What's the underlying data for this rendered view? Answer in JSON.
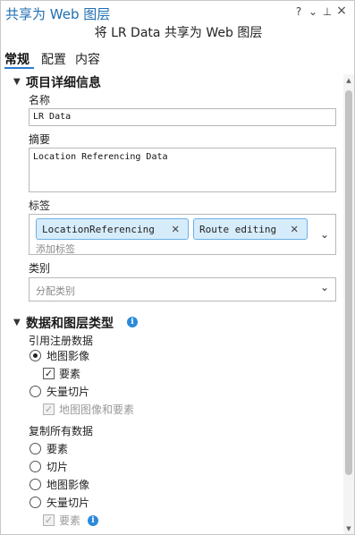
{
  "window": {
    "title": "共享为 Web 图层",
    "controls": {
      "help": "?",
      "menu": "⌄",
      "pin": "⊥",
      "close": "×"
    },
    "subtitle": "将 LR Data 共享为 Web 图层"
  },
  "tabs": [
    {
      "label": "常规",
      "active": true
    },
    {
      "label": "配置",
      "active": false
    },
    {
      "label": "内容",
      "active": false
    }
  ],
  "item_details": {
    "header": "项目详细信息",
    "name_label": "名称",
    "name_value": "LR Data",
    "summary_label": "摘要",
    "summary_value": "Location Referencing Data",
    "tags_label": "标签",
    "tags": [
      "LocationReferencing",
      "Route editing"
    ],
    "tags_placeholder": "添加标签",
    "category_label": "类别",
    "category_placeholder": "分配类别"
  },
  "data_layer": {
    "header": "数据和图层类型",
    "reference_group": "引用注册数据",
    "reference_options": [
      {
        "label": "地图影像",
        "selected": true
      },
      {
        "sub": "要素",
        "checked": true,
        "disabled": false
      },
      {
        "label": "矢量切片",
        "selected": false
      },
      {
        "sub": "地图图像和要素",
        "checked": true,
        "disabled": true
      }
    ],
    "copy_group": "复制所有数据",
    "copy_options": [
      {
        "label": "要素",
        "selected": false
      },
      {
        "label": "切片",
        "selected": false
      },
      {
        "label": "地图影像",
        "selected": false
      },
      {
        "label": "矢量切片",
        "selected": false
      },
      {
        "sub": "要素",
        "checked": true,
        "disabled": true
      }
    ]
  },
  "colors": {
    "accent": "#2b7bd0",
    "title": "#1f6fb2",
    "tag_bg": "#d7ecfb",
    "tag_border": "#6bb0e6",
    "info": "#2b8ad8"
  }
}
